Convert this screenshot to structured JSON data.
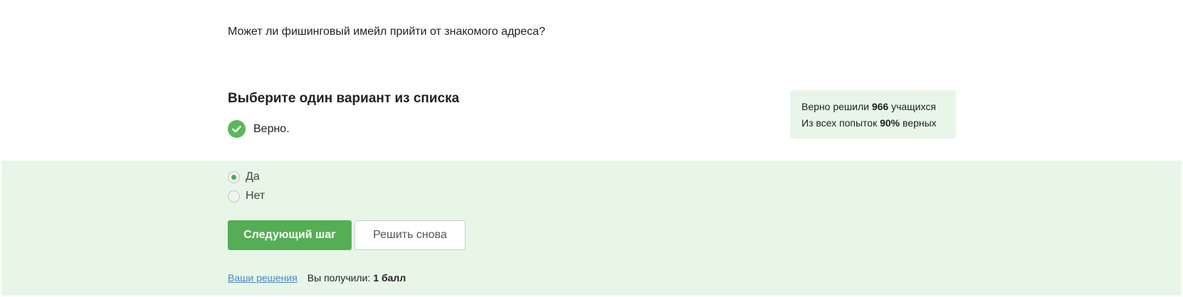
{
  "question": {
    "text": "Может ли фишинговый имейл прийти от знакомого адреса?"
  },
  "instruction": "Выберите один вариант из списка",
  "verdict": {
    "icon": "check-circle-icon",
    "text": "Верно."
  },
  "stats": {
    "line1_prefix": "Верно решили",
    "solved_count": "966",
    "line1_suffix": "учащихся",
    "line2_prefix": "Из всех попыток",
    "percent": "90%",
    "line2_suffix": "верных"
  },
  "options": [
    {
      "label": "Да",
      "selected": true
    },
    {
      "label": "Нет",
      "selected": false
    }
  ],
  "buttons": {
    "next": "Следующий шаг",
    "retry": "Решить снова"
  },
  "footer": {
    "solutions_link": "Ваши решения",
    "score_label": "Вы получили:",
    "score_value": "1 балл"
  },
  "colors": {
    "accent_green": "#55ad55",
    "answer_bg": "#e8f6e8",
    "stats_bg": "#e8f5e9",
    "link_blue": "#4a86c5"
  }
}
